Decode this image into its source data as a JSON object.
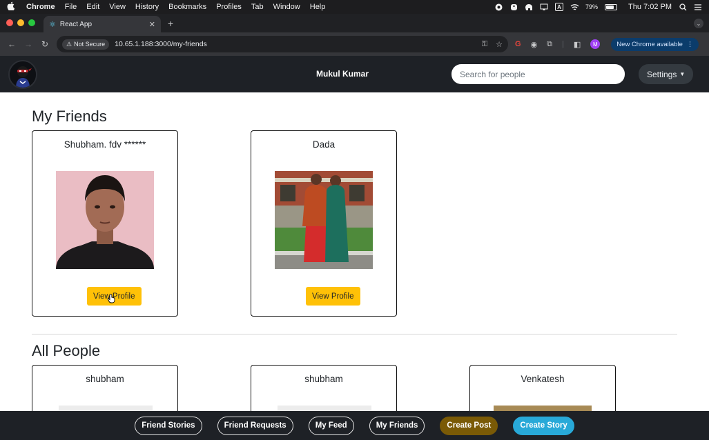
{
  "menubar": {
    "app": "Chrome",
    "items": [
      "File",
      "Edit",
      "View",
      "History",
      "Bookmarks",
      "Profiles",
      "Tab",
      "Window",
      "Help"
    ],
    "battery": "79%",
    "clock": "Thu 7:02 PM",
    "input_badge": "A"
  },
  "browser": {
    "tab_title": "React App",
    "security": "Not Secure",
    "url": "10.65.1.188:3000/my-friends",
    "profile_initial": "M",
    "update_label": "New Chrome available"
  },
  "navbar": {
    "user_name": "Mukul Kumar",
    "search_placeholder": "Search for people",
    "settings_label": "Settings"
  },
  "friends": {
    "title": "My Friends",
    "cards": [
      {
        "name": "Shubham. fdv ******",
        "button": "View Profile"
      },
      {
        "name": "Dada",
        "button": "View Profile"
      }
    ]
  },
  "people": {
    "title": "All People",
    "cards": [
      {
        "name": "shubham"
      },
      {
        "name": "shubham"
      },
      {
        "name": "Venkatesh"
      }
    ]
  },
  "bottom_nav": {
    "friend_stories": "Friend Stories",
    "friend_requests": "Friend Requests",
    "my_feed": "My Feed",
    "my_friends": "My Friends",
    "create_post": "Create Post",
    "create_story": "Create Story"
  },
  "colors": {
    "navbar_bg": "#1e2126",
    "view_button": "#ffc107",
    "create_post": "#7a5a06",
    "create_story": "#28a9d8"
  }
}
